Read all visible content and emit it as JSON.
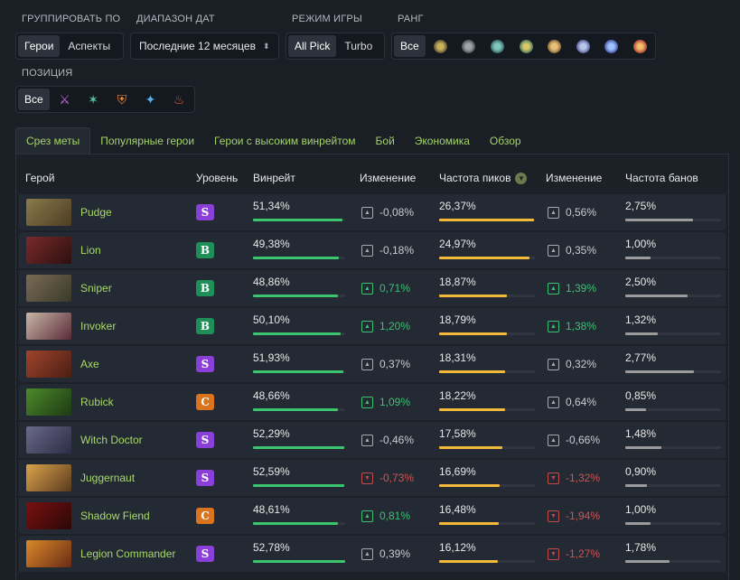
{
  "filters": {
    "group_by": {
      "label": "ГРУППИРОВАТЬ ПО",
      "options": [
        "Герои",
        "Аспекты"
      ],
      "active": 0
    },
    "date_range": {
      "label": "ДИАПАЗОН ДАТ",
      "value": "Последние 12 месяцев"
    },
    "game_mode": {
      "label": "РЕЖИМ ИГРЫ",
      "options": [
        "All Pick",
        "Turbo"
      ],
      "active": 0
    },
    "rank": {
      "label": "РАНГ",
      "all_label": "Все",
      "icons": [
        "herald-rank-icon",
        "guardian-rank-icon",
        "crusader-rank-icon",
        "archon-rank-icon",
        "legend-rank-icon",
        "ancient-rank-icon",
        "divine-rank-icon",
        "immortal-rank-icon"
      ]
    },
    "position": {
      "label": "ПОЗИЦИЯ",
      "all_label": "Все",
      "icons": [
        "carry-position-icon",
        "mid-position-icon",
        "offlane-position-icon",
        "soft-support-position-icon",
        "hard-support-position-icon"
      ]
    }
  },
  "tabs": [
    "Срез меты",
    "Популярные герои",
    "Герои с высоким винрейтом",
    "Бой",
    "Экономика",
    "Обзор"
  ],
  "active_tab": 0,
  "table": {
    "headers": {
      "hero": "Герой",
      "tier": "Уровень",
      "winrate": "Винрейт",
      "change1": "Изменение",
      "pickrate": "Частота пиков",
      "change2": "Изменение",
      "banrate": "Частота банов"
    },
    "rows": [
      {
        "hero": "Pudge",
        "tier": "S",
        "winrate": "51,34%",
        "wr_fill": 0.97,
        "chg1": "-0,08%",
        "chg1_dir": "neu",
        "pick": "26,37%",
        "pick_fill": 0.99,
        "chg2": "0,56%",
        "chg2_dir": "neu",
        "ban": "2,75%",
        "ban_fill": 0.71
      },
      {
        "hero": "Lion",
        "tier": "B",
        "winrate": "49,38%",
        "wr_fill": 0.93,
        "chg1": "-0,18%",
        "chg1_dir": "neu",
        "pick": "24,97%",
        "pick_fill": 0.94,
        "chg2": "0,35%",
        "chg2_dir": "neu",
        "ban": "1,00%",
        "ban_fill": 0.26
      },
      {
        "hero": "Sniper",
        "tier": "B",
        "winrate": "48,86%",
        "wr_fill": 0.92,
        "chg1": "0,71%",
        "chg1_dir": "pos",
        "pick": "18,87%",
        "pick_fill": 0.71,
        "chg2": "1,39%",
        "chg2_dir": "pos",
        "ban": "2,50%",
        "ban_fill": 0.65
      },
      {
        "hero": "Invoker",
        "tier": "B",
        "winrate": "50,10%",
        "wr_fill": 0.95,
        "chg1": "1,20%",
        "chg1_dir": "pos",
        "pick": "18,79%",
        "pick_fill": 0.71,
        "chg2": "1,38%",
        "chg2_dir": "pos",
        "ban": "1,32%",
        "ban_fill": 0.34
      },
      {
        "hero": "Axe",
        "tier": "S",
        "winrate": "51,93%",
        "wr_fill": 0.98,
        "chg1": "0,37%",
        "chg1_dir": "neu",
        "pick": "18,31%",
        "pick_fill": 0.69,
        "chg2": "0,32%",
        "chg2_dir": "neu",
        "ban": "2,77%",
        "ban_fill": 0.72
      },
      {
        "hero": "Rubick",
        "tier": "C",
        "winrate": "48,66%",
        "wr_fill": 0.92,
        "chg1": "1,09%",
        "chg1_dir": "pos",
        "pick": "18,22%",
        "pick_fill": 0.69,
        "chg2": "0,64%",
        "chg2_dir": "neu",
        "ban": "0,85%",
        "ban_fill": 0.22
      },
      {
        "hero": "Witch Doctor",
        "tier": "S",
        "winrate": "52,29%",
        "wr_fill": 0.99,
        "chg1": "-0,46%",
        "chg1_dir": "neu",
        "pick": "17,58%",
        "pick_fill": 0.66,
        "chg2": "-0,66%",
        "chg2_dir": "neu",
        "ban": "1,48%",
        "ban_fill": 0.38
      },
      {
        "hero": "Juggernaut",
        "tier": "S",
        "winrate": "52,59%",
        "wr_fill": 0.99,
        "chg1": "-0,73%",
        "chg1_dir": "neg",
        "pick": "16,69%",
        "pick_fill": 0.63,
        "chg2": "-1,32%",
        "chg2_dir": "neg",
        "ban": "0,90%",
        "ban_fill": 0.23
      },
      {
        "hero": "Shadow Fiend",
        "tier": "C",
        "winrate": "48,61%",
        "wr_fill": 0.92,
        "chg1": "0,81%",
        "chg1_dir": "pos",
        "pick": "16,48%",
        "pick_fill": 0.62,
        "chg2": "-1,94%",
        "chg2_dir": "neg",
        "ban": "1,00%",
        "ban_fill": 0.26
      },
      {
        "hero": "Legion Commander",
        "tier": "S",
        "winrate": "52,78%",
        "wr_fill": 1.0,
        "chg1": "0,39%",
        "chg1_dir": "neu",
        "pick": "16,12%",
        "pick_fill": 0.61,
        "chg2": "-1,27%",
        "chg2_dir": "neg",
        "ban": "1,78%",
        "ban_fill": 0.46
      }
    ]
  },
  "colors": {
    "tier_S": "#8b3fd9",
    "tier_B": "#1f8f5a",
    "tier_C": "#d9731e",
    "winrate_bar": "#3cc46e",
    "pickrate_bar": "#f2b93b",
    "banrate_bar": "#9b9b9b",
    "hero_link": "#a6d96a"
  }
}
